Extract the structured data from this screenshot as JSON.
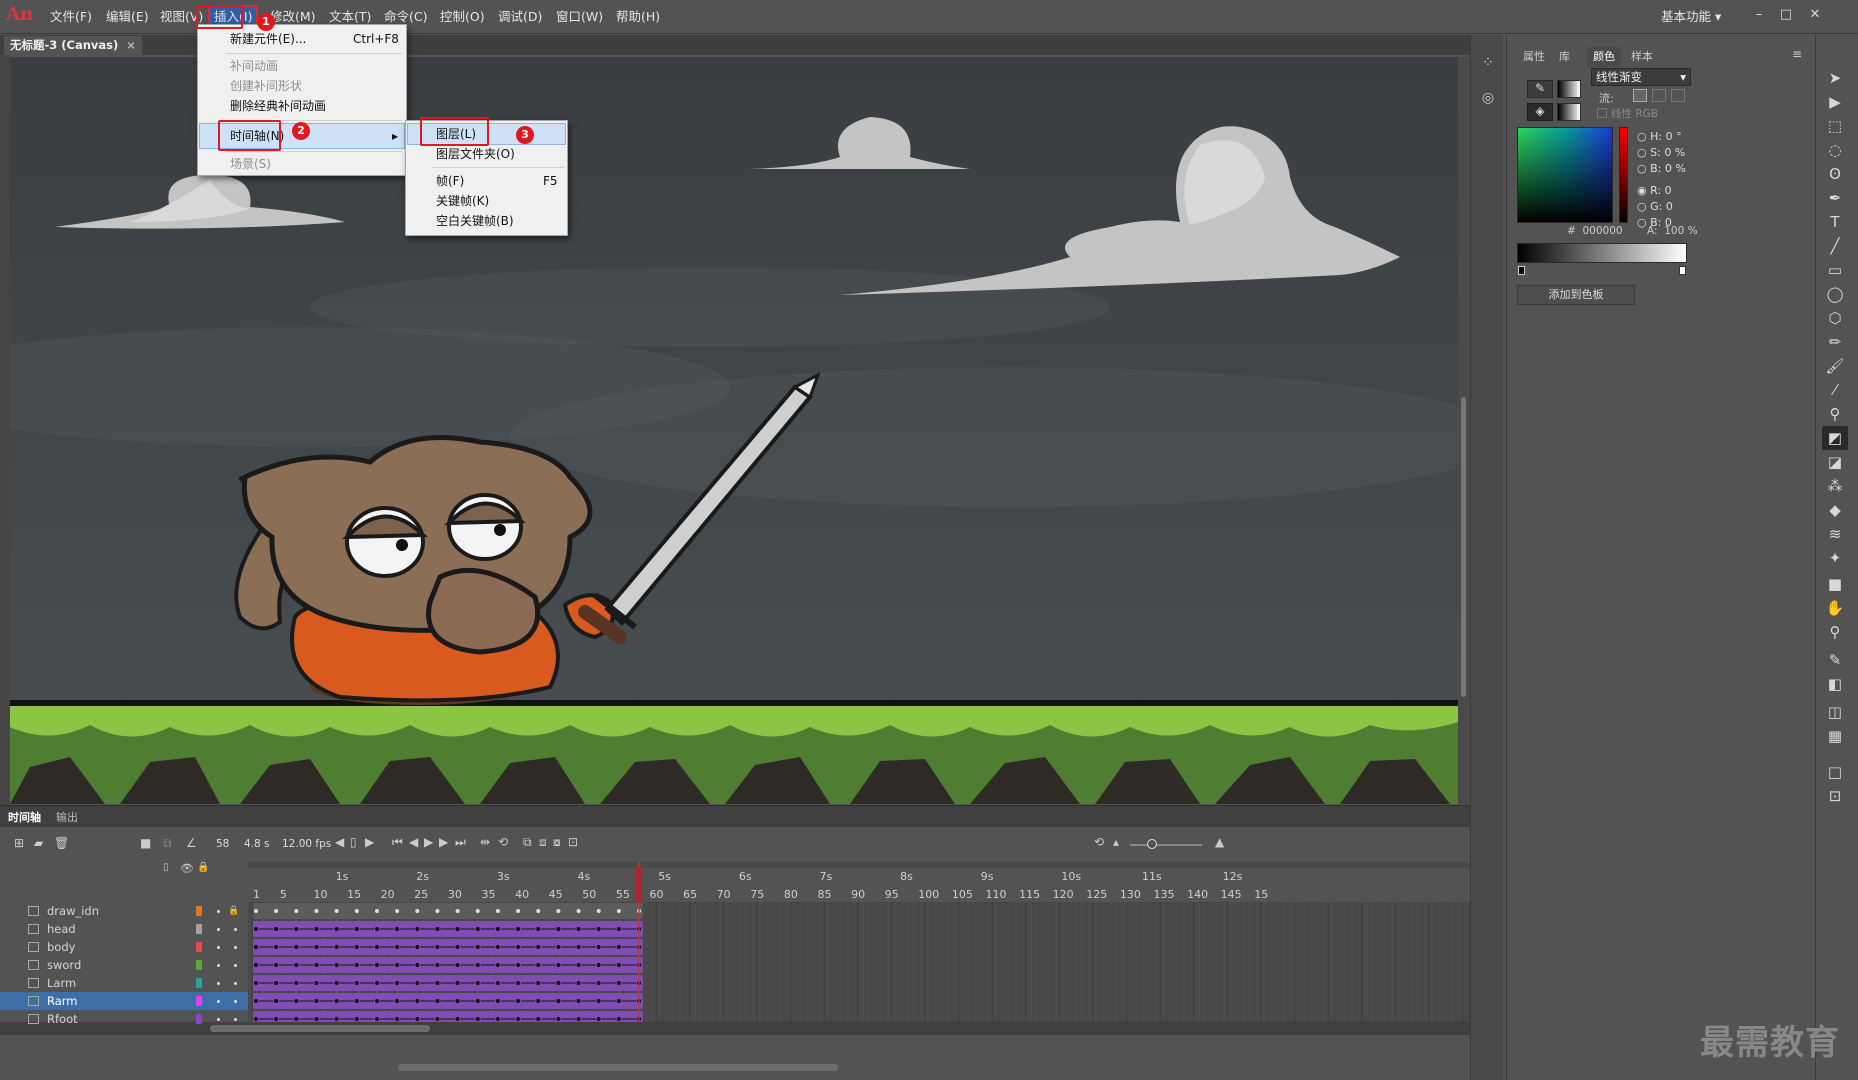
{
  "app": {
    "logo": "An",
    "workspace": "基本功能"
  },
  "menubar": {
    "items": [
      "文件(F)",
      "编辑(E)",
      "视图(V)",
      "插入(I)",
      "修改(M)",
      "文本(T)",
      "命令(C)",
      "控制(O)",
      "调试(D)",
      "窗口(W)",
      "帮助(H)"
    ]
  },
  "document_tab": {
    "title": "无标题-3 (Canvas)",
    "close": "×"
  },
  "insert_menu": {
    "items": [
      {
        "label": "新建元件(E)...",
        "shortcut": "Ctrl+F8",
        "enabled": true
      },
      {
        "label": "补间动画",
        "enabled": false
      },
      {
        "label": "创建补间形状",
        "enabled": false
      },
      {
        "label": "删除经典补间动画",
        "enabled": true
      },
      {
        "label": "时间轴(N)",
        "enabled": true,
        "submenu_arrow": "▸",
        "highlighted": true
      },
      {
        "label": "场景(S)",
        "enabled": false
      }
    ]
  },
  "timeline_submenu": {
    "items": [
      {
        "label": "图层(L)",
        "highlighted": true
      },
      {
        "label": "图层文件夹(O)"
      },
      {
        "label": "帧(F)",
        "shortcut": "F5"
      },
      {
        "label": "关键帧(K)"
      },
      {
        "label": "空白关键帧(B)"
      }
    ]
  },
  "callouts": [
    "1",
    "2",
    "3"
  ],
  "color_panel": {
    "tabs": [
      "属性",
      "库",
      "颜色",
      "样本"
    ],
    "active_tab": "颜色",
    "fill_type": "线性渐变",
    "flow_label": "流:",
    "linear_rgb": "线性 RGB",
    "hsb": [
      {
        "k": "H:",
        "v": "0 °"
      },
      {
        "k": "S:",
        "v": "0 %"
      },
      {
        "k": "B:",
        "v": "0 %"
      }
    ],
    "rgb": [
      {
        "k": "R:",
        "v": "0"
      },
      {
        "k": "G:",
        "v": "0"
      },
      {
        "k": "B:",
        "v": "0"
      }
    ],
    "hex_label": "#",
    "hex": "000000",
    "alpha_label": "A:",
    "alpha": "100 %",
    "add_swatch": "添加到色板",
    "selected_color": "#000000"
  },
  "timeline": {
    "tabs": [
      "时间轴",
      "输出"
    ],
    "current_frame": "58",
    "time": "4.8 s",
    "fps": "12.00 fps",
    "seconds": [
      "1s",
      "2s",
      "3s",
      "4s",
      "5s",
      "6s",
      "7s",
      "8s",
      "9s",
      "10s",
      "11s",
      "12s"
    ],
    "frame_ticks": [
      "1",
      "5",
      "10",
      "15",
      "20",
      "25",
      "30",
      "35",
      "40",
      "45",
      "50",
      "55",
      "60",
      "65",
      "70",
      "75",
      "80",
      "85",
      "90",
      "95",
      "100",
      "105",
      "110",
      "115",
      "120",
      "125",
      "130",
      "135",
      "140",
      "145",
      "15"
    ],
    "layers": [
      {
        "name": "draw_idn",
        "color": "#e07a21",
        "locked": true,
        "selected": false
      },
      {
        "name": "head",
        "color": "#a0a0a0",
        "locked": false,
        "selected": false
      },
      {
        "name": "body",
        "color": "#e84a4a",
        "locked": false,
        "selected": false
      },
      {
        "name": "sword",
        "color": "#5aa83b",
        "locked": false,
        "selected": false
      },
      {
        "name": "Larm",
        "color": "#23a59a",
        "locked": false,
        "selected": false
      },
      {
        "name": "Rarm",
        "color": "#e040e8",
        "locked": false,
        "selected": true
      },
      {
        "name": "Rfoot",
        "color": "#8844cc",
        "locked": false,
        "selected": false
      }
    ]
  },
  "watermark": "最需教育"
}
